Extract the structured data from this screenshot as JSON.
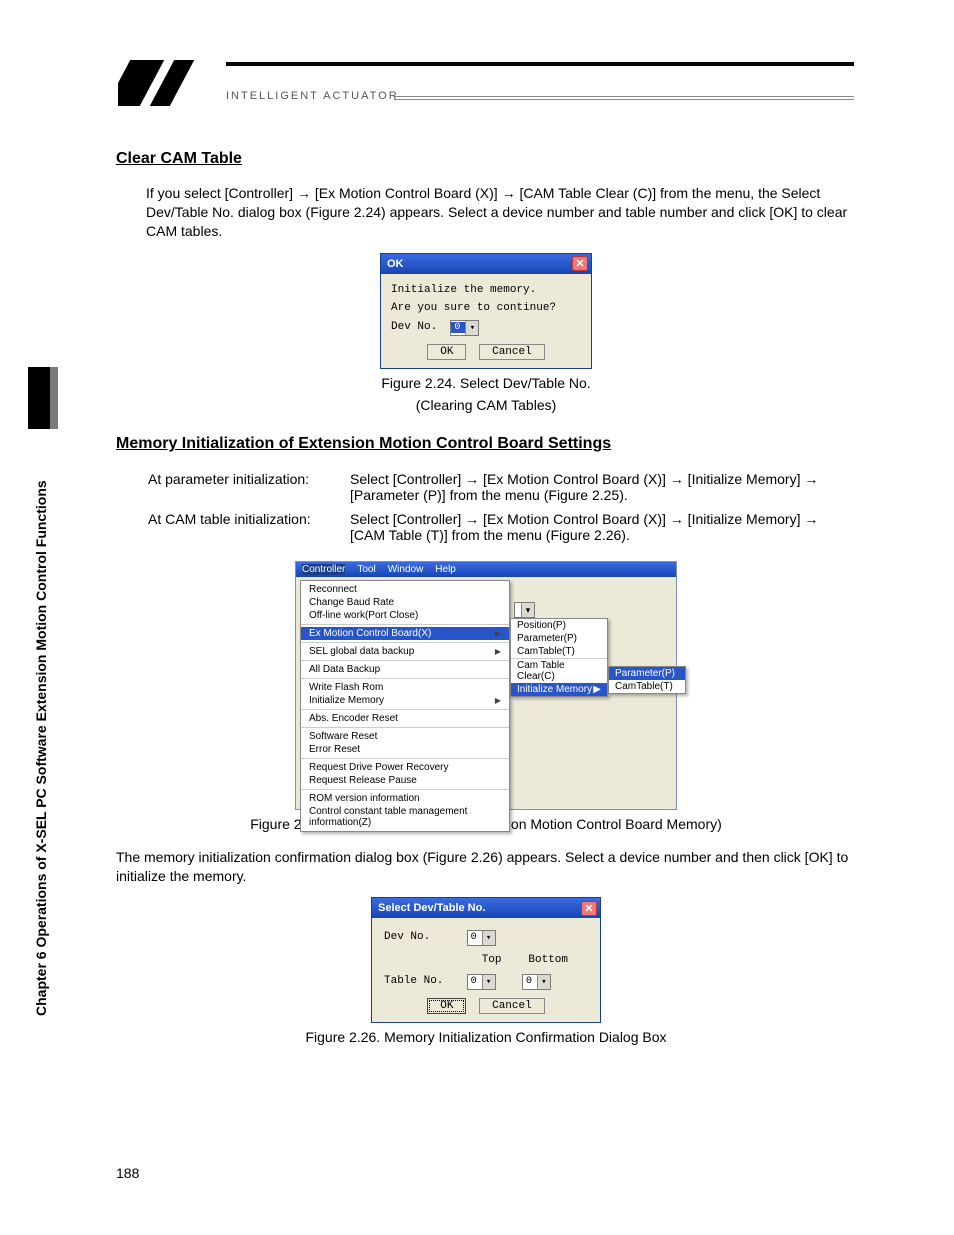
{
  "brand_text": "INTELLIGENT ACTUATOR",
  "side_label": "Chapter 6 Operations of X-SEL PC Software Extension Motion Control Functions",
  "section1": {
    "title": "Clear CAM Table",
    "para": "If you select [Controller] → [Ex Motion Control Board (X)] → [CAM Table Clear (C)] from the menu, the Select Dev/Table No. dialog box (Figure 2.24) appears. Select a device number and table number and click [OK] to clear CAM tables."
  },
  "dlg1": {
    "title": "OK",
    "line1": "Initialize the memory.",
    "line2": "Are you sure to continue?",
    "devno_label": "Dev No.",
    "devno_value": "0",
    "ok": "OK",
    "cancel": "Cancel"
  },
  "caption224a": "Figure 2.24. Select Dev/Table No.",
  "caption224b": "(Clearing CAM Tables)",
  "section2": {
    "title": "Memory Initialization of Extension Motion Control Board Settings",
    "rowA_l": "At parameter initialization:",
    "rowA_r": "Select [Controller] → [Ex Motion Control Board (X)] → [Initialize Memory] → [Parameter (P)] from the menu (Figure 2.25).",
    "rowB_l": "At CAM table initialization:",
    "rowB_r": "Select [Controller] → [Ex Motion Control Board (X)] → [Initialize Memory] → [CAM Table (T)] from the menu (Figure 2.26)."
  },
  "menu": {
    "bar": {
      "controller": "Controller",
      "tool": "Tool",
      "window": "Window",
      "help": "Help"
    },
    "items": {
      "reconnect": "Reconnect",
      "baud": "Change Baud Rate",
      "offline": "Off-line work(Port Close)",
      "exmotion": "Ex Motion Control Board(X)",
      "selglobal": "SEL global data backup",
      "alldata": "All Data Backup",
      "writeflash": "Write Flash Rom",
      "initmem": "Initialize Memory",
      "absenc": "Abs. Encoder Reset",
      "swreset": "Software Reset",
      "errreset": "Error Reset",
      "reqdrive": "Request Drive Power Recovery",
      "reqpause": "Request Release Pause",
      "romver": "ROM version information",
      "ctrlconst": "Control constant table management information(Z)"
    },
    "sub1": {
      "position": "Position(P)",
      "parameter": "Parameter(P)",
      "camtable": "CamTable(T)",
      "camclear": "Cam Table Clear(C)",
      "initmem": "Initialize Memory"
    },
    "sub2": {
      "parameter": "Parameter(P)",
      "camtable": "CamTable(T)"
    }
  },
  "caption225": "Figure 2.25. Menu (Initialization of Extension Motion Control Board Memory)",
  "para3": "The memory initialization confirmation dialog box (Figure 2.26) appears. Select a device number and then click [OK] to initialize the memory.",
  "dlg2": {
    "title": "Select Dev/Table No.",
    "devno_label": "Dev No.",
    "devno_value": "0",
    "top": "Top",
    "bottom": "Bottom",
    "tableno_label": "Table No.",
    "top_value": "0",
    "bottom_value": "0",
    "ok": "OK",
    "cancel": "Cancel"
  },
  "caption226": "Figure 2.26. Memory Initialization Confirmation Dialog Box",
  "page_number": "188"
}
